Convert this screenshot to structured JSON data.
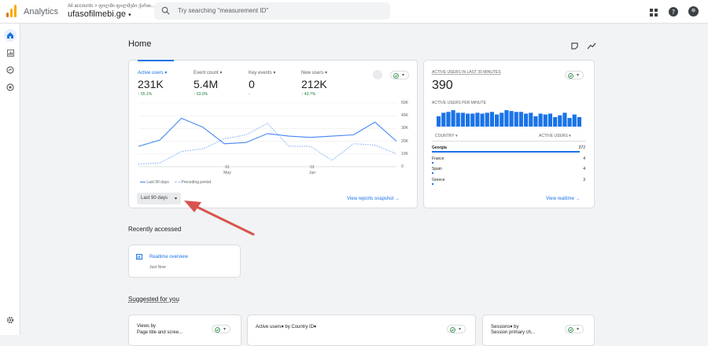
{
  "app": {
    "brand": "Analytics",
    "breadcrumb": "All accounts > ფილმი ფილმები ქართ...",
    "property": "ufasofilmebi.ge"
  },
  "search": {
    "placeholder": "Try searching \"measurement ID\""
  },
  "page": {
    "title": "Home"
  },
  "metrics": [
    {
      "label": "Active users",
      "value": "231K",
      "delta": "↑ 55.1%"
    },
    {
      "label": "Event count",
      "value": "5.4M",
      "delta": "↑ 63.0%"
    },
    {
      "label": "Key events",
      "value": "0",
      "delta": "-"
    },
    {
      "label": "New users",
      "value": "212K",
      "delta": "↑ 43.7%"
    }
  ],
  "chart_data": {
    "type": "line",
    "y_ticks": [
      "50K",
      "40K",
      "30K",
      "20K",
      "10K",
      "0"
    ],
    "ylim": [
      0,
      50000
    ],
    "x_labels": [
      {
        "day": "01",
        "month": "May"
      },
      {
        "day": "01",
        "month": "Jun"
      }
    ],
    "series": [
      {
        "name": "Last 90 days",
        "style": "solid",
        "color": "#4285f4",
        "values": [
          16000,
          21000,
          38000,
          31000,
          18000,
          19000,
          26000,
          24000,
          23000,
          24000,
          25000,
          35000,
          20000
        ]
      },
      {
        "name": "Preceding period",
        "style": "dashed",
        "color": "#8ab4f8",
        "values": [
          2000,
          3000,
          12000,
          14000,
          22000,
          25000,
          34000,
          16000,
          16000,
          5000,
          18000,
          17000,
          10000
        ]
      }
    ]
  },
  "overview": {
    "range_label": "Last 90 days",
    "snapshot_link": "View reports snapshot"
  },
  "realtime": {
    "title": "ACTIVE USERS IN LAST 30 MINUTES",
    "value": "390",
    "per_minute_label": "ACTIVE USERS PER MINUTE",
    "col_country": "COUNTRY",
    "col_users": "ACTIVE USERS",
    "per_minute": [
      12,
      16,
      17,
      19,
      16,
      16,
      15,
      15,
      16,
      15,
      16,
      17,
      14,
      16,
      19,
      18,
      17,
      17,
      15,
      16,
      12,
      15,
      14,
      15,
      11,
      13,
      16,
      10,
      14,
      11
    ],
    "countries": [
      {
        "name": "Georgia",
        "value": "372",
        "share": 1.0
      },
      {
        "name": "France",
        "value": "4",
        "share": 0.011
      },
      {
        "name": "Spain",
        "value": "4",
        "share": 0.011
      },
      {
        "name": "Greece",
        "value": "3",
        "share": 0.008
      }
    ],
    "link": "View realtime"
  },
  "recent": {
    "heading": "Recently accessed",
    "item": "Realtime overview",
    "when": "Just Now"
  },
  "suggested": {
    "heading": "Suggested for you",
    "cards": [
      "Views by",
      "Active users▾ by Country ID▾",
      "Sessions▾ by"
    ],
    "subs": [
      "Page title and scree...",
      "",
      "Session primary ch..."
    ]
  },
  "colors": {
    "accent": "#1a73e8",
    "positive": "#188038",
    "annotation_arrow": "#d9534f"
  }
}
